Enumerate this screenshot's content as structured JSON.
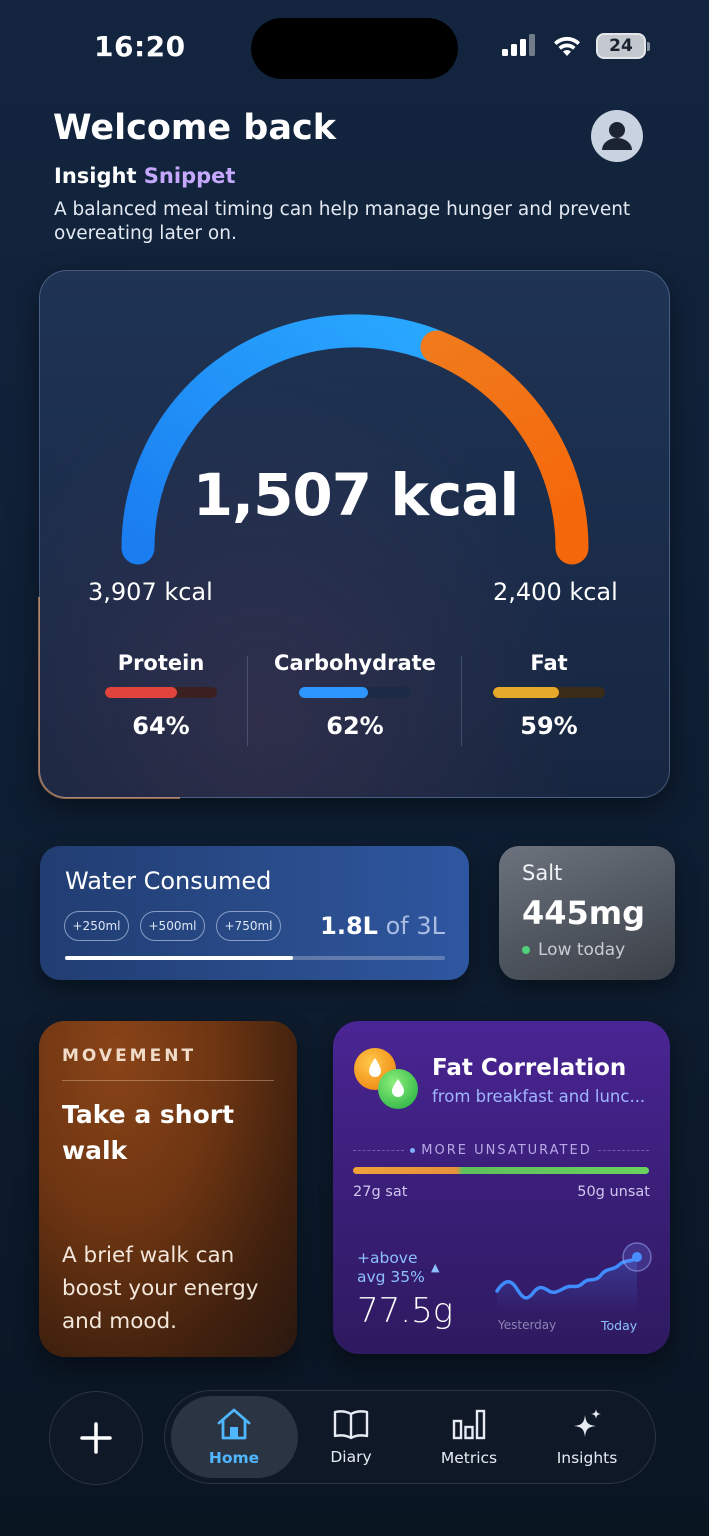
{
  "status_bar": {
    "time": "16:20",
    "battery": "24"
  },
  "header": {
    "title": "Welcome back",
    "insight_label_1": "Insight",
    "insight_label_2": "Snippet",
    "insight_text": "A balanced meal timing can help manage hunger and prevent overeating later on."
  },
  "calories": {
    "consumed": "1,507 kcal",
    "left_label": "3,907 kcal",
    "right_label": "2,400 kcal",
    "colors": {
      "blue": "#1e8ff5",
      "orange": "#f2730f"
    }
  },
  "macros": [
    {
      "name": "Protein",
      "percent": "64%",
      "value": 64,
      "color": "#e0443c",
      "track": "#3a2020"
    },
    {
      "name": "Carbohydrate",
      "percent": "62%",
      "value": 62,
      "color": "#2e96ff",
      "track": "#1d2a45"
    },
    {
      "name": "Fat",
      "percent": "59%",
      "value": 59,
      "color": "#e6a92a",
      "track": "#3a2a18"
    }
  ],
  "water": {
    "title": "Water Consumed",
    "chips": [
      "+250ml",
      "+500ml",
      "+750ml"
    ],
    "amount": "1.8L",
    "of_text": "of 3L",
    "progress": 0.6
  },
  "salt": {
    "title": "Salt",
    "value": "445mg",
    "status": "Low today"
  },
  "movement": {
    "tag": "MOVEMENT",
    "title": "Take a short walk",
    "description": "A brief walk can boost your energy and mood."
  },
  "fat_correlation": {
    "title": "Fat Correlation",
    "subtitle": "from breakfast and lunc...",
    "more_label": "MORE UNSATURATED",
    "sat": "27g sat",
    "unsat": "50g unsat",
    "above_avg": "+above avg 35%",
    "arrow": "▲",
    "value": "77.5g",
    "yesterday": "Yesterday",
    "today": "Today"
  },
  "nav": {
    "items": [
      {
        "label": "Home",
        "icon": "home-icon"
      },
      {
        "label": "Diary",
        "icon": "book-icon"
      },
      {
        "label": "Metrics",
        "icon": "bar-chart-icon"
      },
      {
        "label": "Insights",
        "icon": "sparkles-icon"
      }
    ]
  }
}
